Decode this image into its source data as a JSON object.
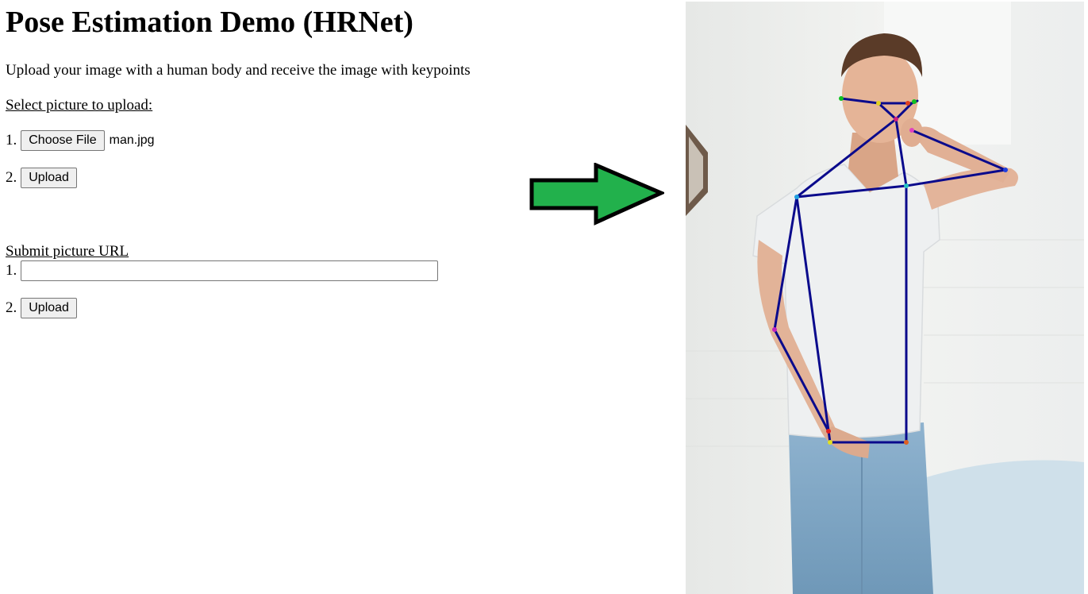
{
  "header": {
    "title": "Pose Estimation Demo (HRNet)",
    "description": "Upload your image with a human body and receive the image with keypoints"
  },
  "upload_section": {
    "label": "Select picture to upload:",
    "step1_number": "1.",
    "choose_file_label": "Choose File",
    "file_name": "man.jpg",
    "step2_number": "2.",
    "upload_label": "Upload"
  },
  "url_section": {
    "label": "Submit picture URL",
    "step1_number": "1.",
    "url_value": "",
    "url_placeholder": "",
    "step2_number": "2.",
    "upload_label": "Upload"
  },
  "colors": {
    "arrow_fill": "#22b14c",
    "arrow_stroke": "#000000",
    "skeleton": "#0a0a8c"
  },
  "icons": {
    "arrow": "right-arrow-icon"
  }
}
